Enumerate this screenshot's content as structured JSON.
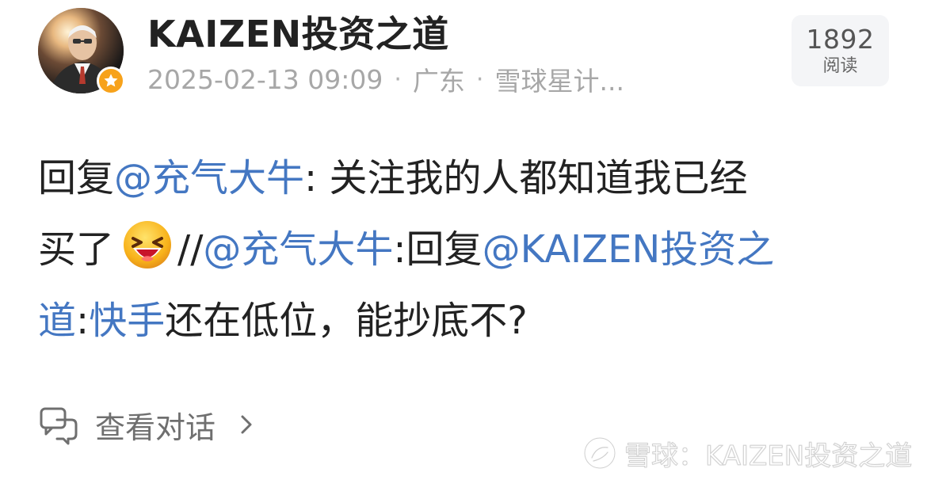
{
  "header": {
    "author_name": "KAIZEN投资之道",
    "meta": {
      "datetime": "2025-02-13 09:09",
      "location": "广东",
      "source": "雪球星计..."
    },
    "read_stats": {
      "count": "1892",
      "label": "阅读"
    }
  },
  "post": {
    "line1": {
      "prefix": "回复",
      "mention": "@充气大牛",
      "suffix": ": 关注我的人都知道我已经"
    },
    "line2": {
      "prefix": "买了",
      "separator": "//",
      "mention1": "@充气大牛",
      "middle": ":回复",
      "mention2": "@KAIZEN投资之"
    },
    "line3": {
      "mention_continue": "道",
      "colon": ":",
      "highlight": "快手",
      "suffix": "还在低位，能抄底不?"
    },
    "emoji": "grinning-squinting-face-icon"
  },
  "footer": {
    "view_conversation": "查看对话"
  },
  "watermark": {
    "text": "雪球：KAIZEN投资之道"
  },
  "colors": {
    "mention": "#4477c2",
    "meta": "#a7a7a7",
    "badge": "#f7a21b"
  }
}
